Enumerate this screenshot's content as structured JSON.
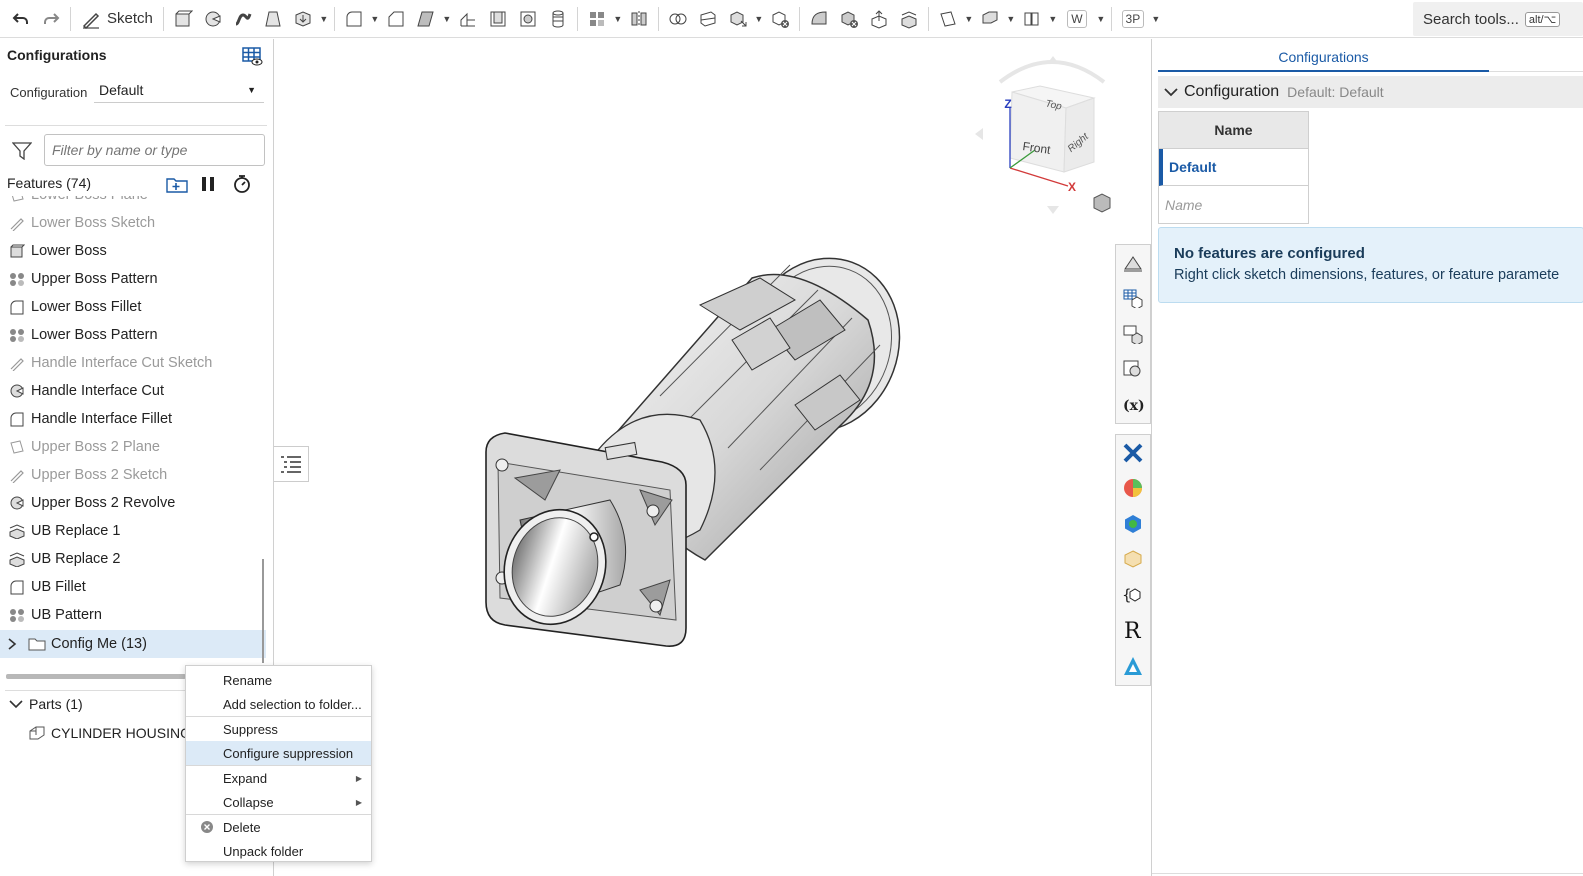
{
  "toolbar": {
    "sketch_label": "Sketch",
    "w_label": "W",
    "threep_label": "3P",
    "search_label": "Search tools...",
    "search_shortcut": "alt/⌥"
  },
  "left_panel": {
    "title": "Configurations",
    "config_label": "Configuration",
    "config_value": "Default",
    "filter_placeholder": "Filter by name or type",
    "features_title": "Features (74)",
    "features": [
      {
        "label": "Lower Boss Plane",
        "icon": "plane-icon",
        "dim": true
      },
      {
        "label": "Lower Boss Sketch",
        "icon": "sketch-icon",
        "dim": true
      },
      {
        "label": "Lower Boss",
        "icon": "extrude-icon",
        "dim": false
      },
      {
        "label": "Upper Boss Pattern",
        "icon": "pattern-icon",
        "dim": false
      },
      {
        "label": "Lower Boss Fillet",
        "icon": "fillet-icon",
        "dim": false
      },
      {
        "label": "Lower Boss Pattern",
        "icon": "pattern-icon",
        "dim": false
      },
      {
        "label": "Handle Interface Cut Sketch",
        "icon": "sketch-icon",
        "dim": true
      },
      {
        "label": "Handle Interface Cut",
        "icon": "revolve-icon",
        "dim": false
      },
      {
        "label": "Handle Interface Fillet",
        "icon": "fillet-icon",
        "dim": false
      },
      {
        "label": "Upper Boss 2 Plane",
        "icon": "plane-icon",
        "dim": true
      },
      {
        "label": "Upper Boss 2 Sketch",
        "icon": "sketch-icon",
        "dim": true
      },
      {
        "label": "Upper Boss 2 Revolve",
        "icon": "revolve-icon",
        "dim": false
      },
      {
        "label": "UB Replace 1",
        "icon": "replace-face-icon",
        "dim": false
      },
      {
        "label": "UB Replace 2",
        "icon": "replace-face-icon",
        "dim": false
      },
      {
        "label": "UB Fillet",
        "icon": "fillet-icon",
        "dim": false
      },
      {
        "label": "UB Pattern",
        "icon": "pattern-icon",
        "dim": false
      }
    ],
    "folder": {
      "label": "Config Me (13)",
      "icon": "folder-icon"
    },
    "parts_title": "Parts (1)",
    "part_name": "CYLINDER HOUSING"
  },
  "context_menu": {
    "items": [
      {
        "label": "Rename"
      },
      {
        "label": "Add selection to folder..."
      },
      {
        "label": "Suppress"
      },
      {
        "label": "Configure suppression",
        "highlighted": true
      },
      {
        "label": "Expand",
        "submenu": true
      },
      {
        "label": "Collapse",
        "submenu": true
      },
      {
        "label": "Delete",
        "icon": "delete-icon"
      },
      {
        "label": "Unpack folder"
      }
    ]
  },
  "view_cube": {
    "top": "Top",
    "front": "Front",
    "right": "Right",
    "axis_x": "X",
    "axis_z": "Z"
  },
  "right_panel": {
    "tab_label": "Configurations",
    "section_title": "Configuration",
    "section_subtitle": "Default: Default",
    "table_header": "Name",
    "table_default": "Default",
    "name_placeholder": "Name",
    "info_title": "No features are configured",
    "info_text": "Right click sketch dimensions, features, or feature paramete"
  },
  "colors": {
    "accent": "#1a5aa6",
    "selection": "#dceaf7",
    "info_bg": "#e4f1fa"
  }
}
